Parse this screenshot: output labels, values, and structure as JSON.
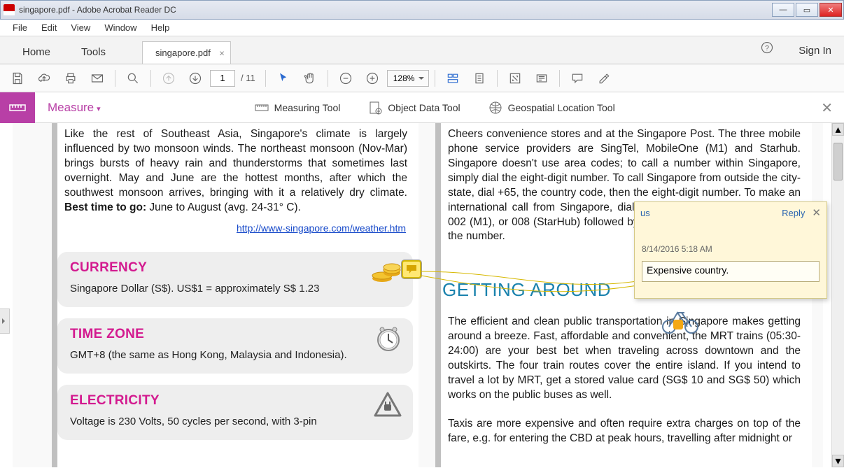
{
  "window": {
    "title": "singapore.pdf - Adobe Acrobat Reader DC"
  },
  "menus": [
    "File",
    "Edit",
    "View",
    "Window",
    "Help"
  ],
  "tabs": {
    "home": "Home",
    "tools": "Tools",
    "doc": "singapore.pdf",
    "signin": "Sign In"
  },
  "toolbar": {
    "page_current": "1",
    "page_total": "/ 11",
    "zoom": "128%"
  },
  "measure": {
    "title": "Measure",
    "tool1": "Measuring Tool",
    "tool2": "Object Data Tool",
    "tool3": "Geospatial Location Tool"
  },
  "doc": {
    "climate": "Like the rest of Southeast Asia, Singapore's climate is largely influenced by two monsoon winds. The northeast monsoon (Nov-Mar) brings bursts of heavy rain and thunderstorms that sometimes last overnight. May and June are the hottest months, after which the southwest monsoon arrives, bringing with it a relatively dry climate.",
    "best_label": "Best time to go:",
    "best_value": " June to August (avg. 24-31° C).",
    "weather_link": "http://www-singapore.com/weather.htm",
    "currency_h": "CURRENCY",
    "currency_p": "Singapore Dollar (S$). US$1 = approximately S$ 1.23",
    "timezone_h": "TIME ZONE",
    "timezone_p": "GMT+8 (the same as Hong Kong, Malaysia and Indonesia).",
    "electricity_h": "ELECTRICITY",
    "electricity_p": "Voltage is 230 Volts, 50 cycles per second, with 3-pin",
    "phones": "Cheers convenience stores and at the Singapore Post. The three mobile phone service providers are SingTel, MobileOne (M1) and Starhub. Singapore doesn't use area codes; to call a number within Singapore, simply dial the eight-digit number. To call Singapore from outside the city-state, dial +65, the country code, then the eight-digit number. To make an international call from Singapore, dial the access code 001 (Sing Tel), 002 (M1), or 008 (StarHub) followed by the country code, area code and the number.",
    "getting_h": "GETTING AROUND",
    "getting_p1": "The efficient and clean public transportation in Singapore makes getting around a breeze. Fast, affordable and convenient, the MRT trains (05:30-24:00) are your best bet when traveling across downtown and the outskirts. The four train routes cover the entire island. If you intend to travel a lot by MRT, get a stored value card (SG$ 10 and SG$ 50) which works on the public buses as well.",
    "getting_p2": "Taxis are more expensive and often require extra charges on top of the fare, e.g. for entering the CBD at peak hours, travelling after midnight or"
  },
  "comment": {
    "author": "us",
    "reply": "Reply",
    "date": "8/14/2016  5:18 AM",
    "text": "Expensive country."
  }
}
